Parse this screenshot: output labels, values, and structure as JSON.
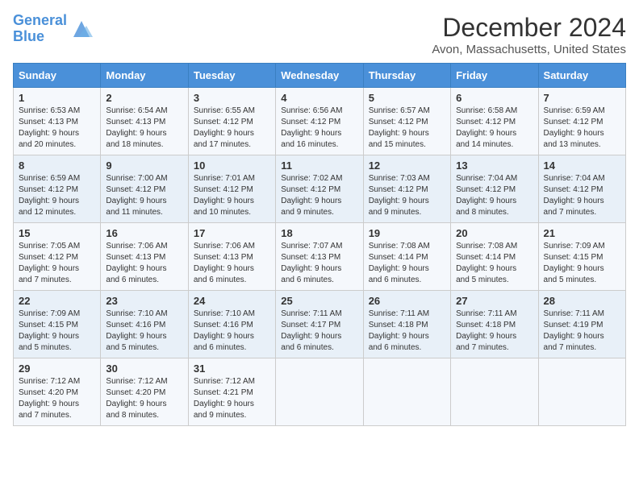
{
  "header": {
    "logo_line1": "General",
    "logo_line2": "Blue",
    "month_year": "December 2024",
    "location": "Avon, Massachusetts, United States"
  },
  "days_of_week": [
    "Sunday",
    "Monday",
    "Tuesday",
    "Wednesday",
    "Thursday",
    "Friday",
    "Saturday"
  ],
  "weeks": [
    [
      {
        "day": "1",
        "lines": [
          "Sunrise: 6:53 AM",
          "Sunset: 4:13 PM",
          "Daylight: 9 hours",
          "and 20 minutes."
        ]
      },
      {
        "day": "2",
        "lines": [
          "Sunrise: 6:54 AM",
          "Sunset: 4:13 PM",
          "Daylight: 9 hours",
          "and 18 minutes."
        ]
      },
      {
        "day": "3",
        "lines": [
          "Sunrise: 6:55 AM",
          "Sunset: 4:12 PM",
          "Daylight: 9 hours",
          "and 17 minutes."
        ]
      },
      {
        "day": "4",
        "lines": [
          "Sunrise: 6:56 AM",
          "Sunset: 4:12 PM",
          "Daylight: 9 hours",
          "and 16 minutes."
        ]
      },
      {
        "day": "5",
        "lines": [
          "Sunrise: 6:57 AM",
          "Sunset: 4:12 PM",
          "Daylight: 9 hours",
          "and 15 minutes."
        ]
      },
      {
        "day": "6",
        "lines": [
          "Sunrise: 6:58 AM",
          "Sunset: 4:12 PM",
          "Daylight: 9 hours",
          "and 14 minutes."
        ]
      },
      {
        "day": "7",
        "lines": [
          "Sunrise: 6:59 AM",
          "Sunset: 4:12 PM",
          "Daylight: 9 hours",
          "and 13 minutes."
        ]
      }
    ],
    [
      {
        "day": "8",
        "lines": [
          "Sunrise: 6:59 AM",
          "Sunset: 4:12 PM",
          "Daylight: 9 hours",
          "and 12 minutes."
        ]
      },
      {
        "day": "9",
        "lines": [
          "Sunrise: 7:00 AM",
          "Sunset: 4:12 PM",
          "Daylight: 9 hours",
          "and 11 minutes."
        ]
      },
      {
        "day": "10",
        "lines": [
          "Sunrise: 7:01 AM",
          "Sunset: 4:12 PM",
          "Daylight: 9 hours",
          "and 10 minutes."
        ]
      },
      {
        "day": "11",
        "lines": [
          "Sunrise: 7:02 AM",
          "Sunset: 4:12 PM",
          "Daylight: 9 hours",
          "and 9 minutes."
        ]
      },
      {
        "day": "12",
        "lines": [
          "Sunrise: 7:03 AM",
          "Sunset: 4:12 PM",
          "Daylight: 9 hours",
          "and 9 minutes."
        ]
      },
      {
        "day": "13",
        "lines": [
          "Sunrise: 7:04 AM",
          "Sunset: 4:12 PM",
          "Daylight: 9 hours",
          "and 8 minutes."
        ]
      },
      {
        "day": "14",
        "lines": [
          "Sunrise: 7:04 AM",
          "Sunset: 4:12 PM",
          "Daylight: 9 hours",
          "and 7 minutes."
        ]
      }
    ],
    [
      {
        "day": "15",
        "lines": [
          "Sunrise: 7:05 AM",
          "Sunset: 4:12 PM",
          "Daylight: 9 hours",
          "and 7 minutes."
        ]
      },
      {
        "day": "16",
        "lines": [
          "Sunrise: 7:06 AM",
          "Sunset: 4:13 PM",
          "Daylight: 9 hours",
          "and 6 minutes."
        ]
      },
      {
        "day": "17",
        "lines": [
          "Sunrise: 7:06 AM",
          "Sunset: 4:13 PM",
          "Daylight: 9 hours",
          "and 6 minutes."
        ]
      },
      {
        "day": "18",
        "lines": [
          "Sunrise: 7:07 AM",
          "Sunset: 4:13 PM",
          "Daylight: 9 hours",
          "and 6 minutes."
        ]
      },
      {
        "day": "19",
        "lines": [
          "Sunrise: 7:08 AM",
          "Sunset: 4:14 PM",
          "Daylight: 9 hours",
          "and 6 minutes."
        ]
      },
      {
        "day": "20",
        "lines": [
          "Sunrise: 7:08 AM",
          "Sunset: 4:14 PM",
          "Daylight: 9 hours",
          "and 5 minutes."
        ]
      },
      {
        "day": "21",
        "lines": [
          "Sunrise: 7:09 AM",
          "Sunset: 4:15 PM",
          "Daylight: 9 hours",
          "and 5 minutes."
        ]
      }
    ],
    [
      {
        "day": "22",
        "lines": [
          "Sunrise: 7:09 AM",
          "Sunset: 4:15 PM",
          "Daylight: 9 hours",
          "and 5 minutes."
        ]
      },
      {
        "day": "23",
        "lines": [
          "Sunrise: 7:10 AM",
          "Sunset: 4:16 PM",
          "Daylight: 9 hours",
          "and 5 minutes."
        ]
      },
      {
        "day": "24",
        "lines": [
          "Sunrise: 7:10 AM",
          "Sunset: 4:16 PM",
          "Daylight: 9 hours",
          "and 6 minutes."
        ]
      },
      {
        "day": "25",
        "lines": [
          "Sunrise: 7:11 AM",
          "Sunset: 4:17 PM",
          "Daylight: 9 hours",
          "and 6 minutes."
        ]
      },
      {
        "day": "26",
        "lines": [
          "Sunrise: 7:11 AM",
          "Sunset: 4:18 PM",
          "Daylight: 9 hours",
          "and 6 minutes."
        ]
      },
      {
        "day": "27",
        "lines": [
          "Sunrise: 7:11 AM",
          "Sunset: 4:18 PM",
          "Daylight: 9 hours",
          "and 7 minutes."
        ]
      },
      {
        "day": "28",
        "lines": [
          "Sunrise: 7:11 AM",
          "Sunset: 4:19 PM",
          "Daylight: 9 hours",
          "and 7 minutes."
        ]
      }
    ],
    [
      {
        "day": "29",
        "lines": [
          "Sunrise: 7:12 AM",
          "Sunset: 4:20 PM",
          "Daylight: 9 hours",
          "and 7 minutes."
        ]
      },
      {
        "day": "30",
        "lines": [
          "Sunrise: 7:12 AM",
          "Sunset: 4:20 PM",
          "Daylight: 9 hours",
          "and 8 minutes."
        ]
      },
      {
        "day": "31",
        "lines": [
          "Sunrise: 7:12 AM",
          "Sunset: 4:21 PM",
          "Daylight: 9 hours",
          "and 9 minutes."
        ]
      },
      {
        "day": "",
        "lines": []
      },
      {
        "day": "",
        "lines": []
      },
      {
        "day": "",
        "lines": []
      },
      {
        "day": "",
        "lines": []
      }
    ]
  ]
}
